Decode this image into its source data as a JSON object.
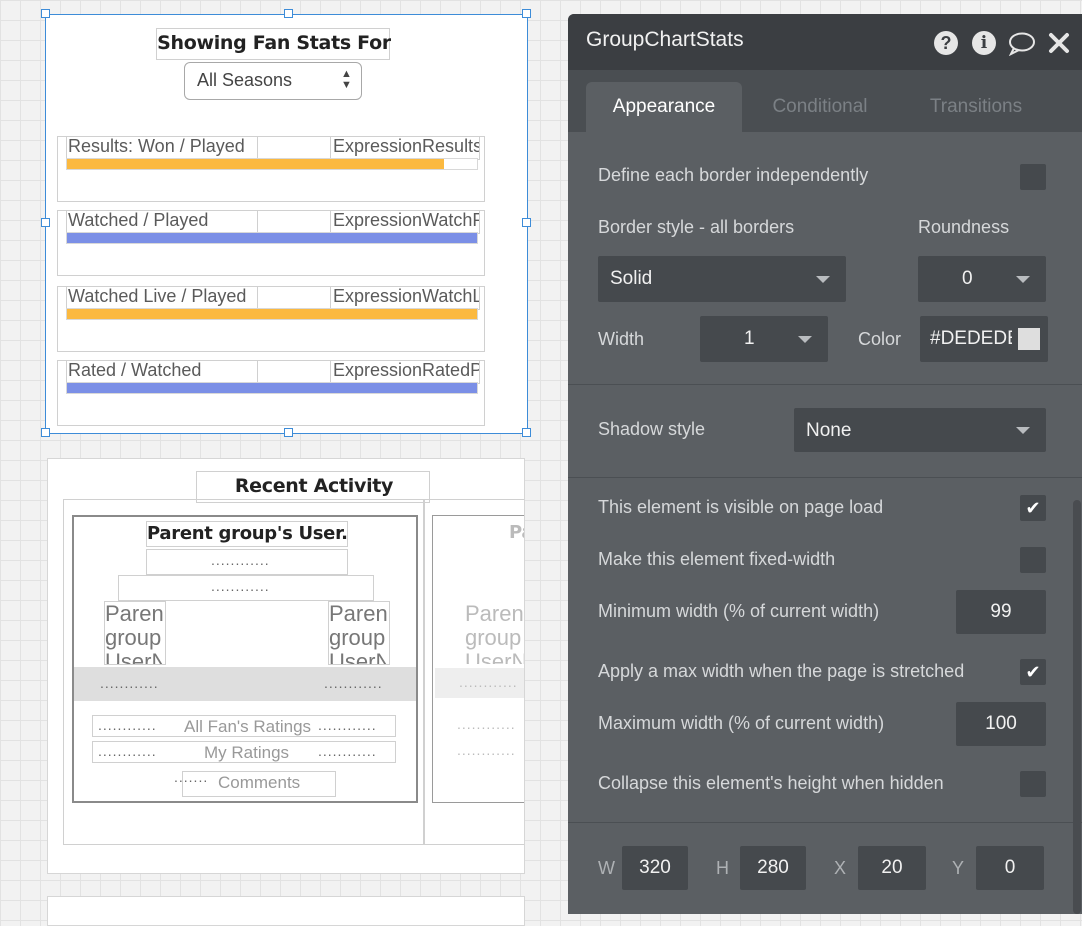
{
  "canvas": {
    "fan_stats": {
      "title": "Showing Fan Stats For",
      "season_select": "All Seasons",
      "rows": [
        {
          "label": "Results: Won / Played",
          "expression": "ExpressionResultsP",
          "fill": 0.92,
          "color": "#fbb940"
        },
        {
          "label": "Watched / Played",
          "expression": "ExpressionWatchPe",
          "fill": 1.0,
          "color": "#7b8fe6"
        },
        {
          "label": "Watched Live / Played",
          "expression": "ExpressionWatchLiv",
          "fill": 1.0,
          "color": "#fbb940"
        },
        {
          "label": "Rated / Watched",
          "expression": "ExpressionRatedPe",
          "fill": 1.0,
          "color": "#7b8fe6"
        }
      ]
    },
    "recent_activity": {
      "title": "Recent Activity",
      "card_title": "Parent group's User...",
      "card_title_partial": "Pa",
      "dots": "............",
      "dots_short": ".......",
      "parent_text": "Parent group UserN",
      "all_ratings": "All Fan's Ratings",
      "my_ratings": "My Ratings",
      "comments": "Comments"
    }
  },
  "panel": {
    "title": "GroupChartStats",
    "icons": [
      "help-icon",
      "info-icon",
      "comment-icon",
      "close-icon"
    ],
    "tabs": [
      "Appearance",
      "Conditional",
      "Transitions"
    ],
    "define_border": "Define each border independently",
    "border_style_label": "Border style - all borders",
    "roundness_label": "Roundness",
    "border_style_value": "Solid",
    "roundness_value": "0",
    "width_label": "Width",
    "width_value": "1",
    "color_label": "Color",
    "color_value": "#DEDEDE",
    "shadow_label": "Shadow style",
    "shadow_value": "None",
    "visible_on_load": "This element is visible on page load",
    "fixed_width": "Make this element fixed-width",
    "min_width_label": "Minimum width (% of current width)",
    "min_width_value": "99",
    "apply_max_width": "Apply a max width when the page is stretched",
    "max_width_label": "Maximum width (% of current width)",
    "max_width_value": "100",
    "collapse_height": "Collapse this element's height when hidden",
    "dims": {
      "w_label": "W",
      "w": "320",
      "h_label": "H",
      "h": "280",
      "x_label": "X",
      "x": "20",
      "y_label": "Y",
      "y": "0"
    }
  }
}
